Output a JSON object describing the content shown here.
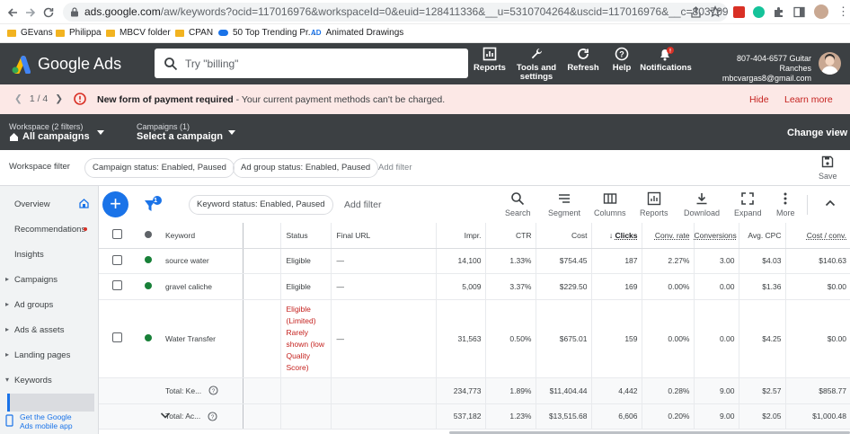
{
  "browser": {
    "url_host": "ads.google.com",
    "url_path": "/aw/keywords?ocid=117016976&workspaceId=0&euid=128411336&__u=5310704264&uscid=117016976&__c=8037092624&authuser...",
    "bookmarks": [
      {
        "label": "GEvans",
        "icon": "folder-icon"
      },
      {
        "label": "Philippa",
        "icon": "folder-icon"
      },
      {
        "label": "MBCV folder",
        "icon": "folder-icon"
      },
      {
        "label": "CPAN",
        "icon": "folder-icon"
      },
      {
        "label": "50 Top Trending Pr...",
        "icon": "cloud-icon"
      },
      {
        "label": "Animated Drawings",
        "icon": "ad-icon"
      }
    ]
  },
  "header": {
    "brand": "Google Ads",
    "search_placeholder": "Try \"billing\"",
    "buttons": [
      {
        "label": "Reports",
        "icon": "reports-icon"
      },
      {
        "label": "Tools and settings",
        "icon": "wrench-icon"
      },
      {
        "label": "Refresh",
        "icon": "refresh-icon"
      },
      {
        "label": "Help",
        "icon": "help-icon"
      },
      {
        "label": "Notifications",
        "icon": "bell-icon"
      }
    ],
    "account_line1": "807-404-6577 Guitar Ranches",
    "account_line2": "mbcvargas8@gmail.com"
  },
  "alert": {
    "pager": "1 / 4",
    "title": "New form of payment required",
    "message": " - Your current payment methods can't be charged.",
    "hide": "Hide",
    "learn_more": "Learn more"
  },
  "workspace": {
    "workspace_label": "Workspace (2 filters)",
    "workspace_value": "All campaigns",
    "campaigns_label": "Campaigns (1)",
    "campaigns_value": "Select a campaign",
    "change_view": "Change view"
  },
  "filters": {
    "label": "Workspace filter",
    "chips": [
      "Campaign status: Enabled, Paused",
      "Ad group status: Enabled, Paused"
    ],
    "add": "Add filter",
    "save": "Save"
  },
  "sidebar": {
    "items": [
      "Overview",
      "Recommendations",
      "Insights",
      "Campaigns",
      "Ad groups",
      "Ads & assets",
      "Landing pages",
      "Keywords"
    ],
    "mobile_line1": "Get the Google",
    "mobile_line2": "Ads mobile app"
  },
  "toolbar": {
    "filter_count": "1",
    "keyword_chip": "Keyword status: Enabled, Paused",
    "add_filter": "Add filter",
    "tools": [
      "Search",
      "Segment",
      "Columns",
      "Reports",
      "Download",
      "Expand",
      "More"
    ]
  },
  "table": {
    "headers": [
      "Keyword",
      "Status",
      "Final URL",
      "Impr.",
      "CTR",
      "Cost",
      "Clicks",
      "Conv. rate",
      "Conversions",
      "Avg. CPC",
      "Cost / conv."
    ],
    "rows": [
      {
        "keyword": "source water",
        "status": "Eligible",
        "url": "—",
        "impr": "14,100",
        "ctr": "1.33%",
        "cost": "$754.45",
        "clicks": "187",
        "convrate": "2.27%",
        "conv": "3.00",
        "cpc": "$4.03",
        "costconv": "$140.63"
      },
      {
        "keyword": "gravel caliche",
        "status": "Eligible",
        "url": "—",
        "impr": "5,009",
        "ctr": "3.37%",
        "cost": "$229.50",
        "clicks": "169",
        "convrate": "0.00%",
        "conv": "0.00",
        "cpc": "$1.36",
        "costconv": "$0.00"
      },
      {
        "keyword": "Water Transfer",
        "status": "Eligible (Limited) Rarely shown (low Quality Score)",
        "url": "—",
        "impr": "31,563",
        "ctr": "0.50%",
        "cost": "$675.01",
        "clicks": "159",
        "convrate": "0.00%",
        "conv": "0.00",
        "cpc": "$4.25",
        "costconv": "$0.00"
      }
    ],
    "totals": [
      {
        "label": "Total: Ke...",
        "impr": "234,773",
        "ctr": "1.89%",
        "cost": "$11,404.44",
        "clicks": "4,442",
        "convrate": "0.28%",
        "conv": "9.00",
        "cpc": "$2.57",
        "costconv": "$858.77"
      },
      {
        "label": "Total: Ac...",
        "impr": "537,182",
        "ctr": "1.23%",
        "cost": "$13,515.68",
        "clicks": "6,606",
        "convrate": "0.20%",
        "conv": "9.00",
        "cpc": "$2.05",
        "costconv": "$1,000.48"
      }
    ]
  },
  "colors": {
    "accent": "#1a73e8",
    "header_bg": "#3c4043",
    "alert_bg": "#fce8e6",
    "eligible_dot": "#188038",
    "limited_text": "#c5221f"
  }
}
